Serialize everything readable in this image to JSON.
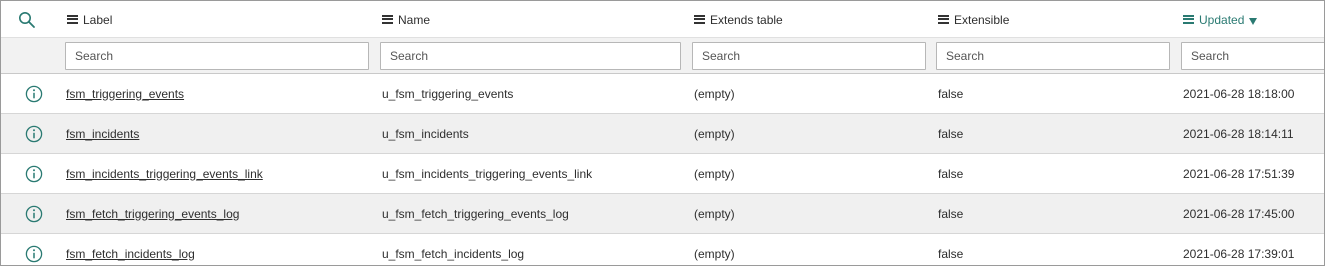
{
  "columns": [
    {
      "label": "Label",
      "sorted": false
    },
    {
      "label": "Name",
      "sorted": false
    },
    {
      "label": "Extends table",
      "sorted": false
    },
    {
      "label": "Extensible",
      "sorted": false
    },
    {
      "label": "Updated",
      "sorted": true,
      "sort_direction": "descending"
    }
  ],
  "search_placeholders": [
    "Search",
    "Search",
    "Search",
    "Search",
    "Search"
  ],
  "rows": [
    {
      "label": "fsm_triggering_events",
      "name": "u_fsm_triggering_events",
      "extends": "(empty)",
      "extensible": "false",
      "updated": "2021-06-28 18:18:00"
    },
    {
      "label": "fsm_incidents",
      "name": "u_fsm_incidents",
      "extends": "(empty)",
      "extensible": "false",
      "updated": "2021-06-28 18:14:11"
    },
    {
      "label": "fsm_incidents_triggering_events_link",
      "name": "u_fsm_incidents_triggering_events_link",
      "extends": "(empty)",
      "extensible": "false",
      "updated": "2021-06-28 17:51:39"
    },
    {
      "label": "fsm_fetch_triggering_events_log",
      "name": "u_fsm_fetch_triggering_events_log",
      "extends": "(empty)",
      "extensible": "false",
      "updated": "2021-06-28 17:45:00"
    },
    {
      "label": "fsm_fetch_incidents_log",
      "name": "u_fsm_fetch_incidents_log",
      "extends": "(empty)",
      "extensible": "false",
      "updated": "2021-06-28 17:39:01"
    }
  ],
  "icons": {
    "search": "search-icon",
    "column_menu": "hamburger-menu-icon",
    "row_info": "info-circle-icon",
    "sort": "sort-descending-arrow-icon"
  },
  "colors": {
    "accent": "#2a7a72",
    "row_alt": "#f0f0f0",
    "search_row_bg": "#f2f2f2"
  }
}
